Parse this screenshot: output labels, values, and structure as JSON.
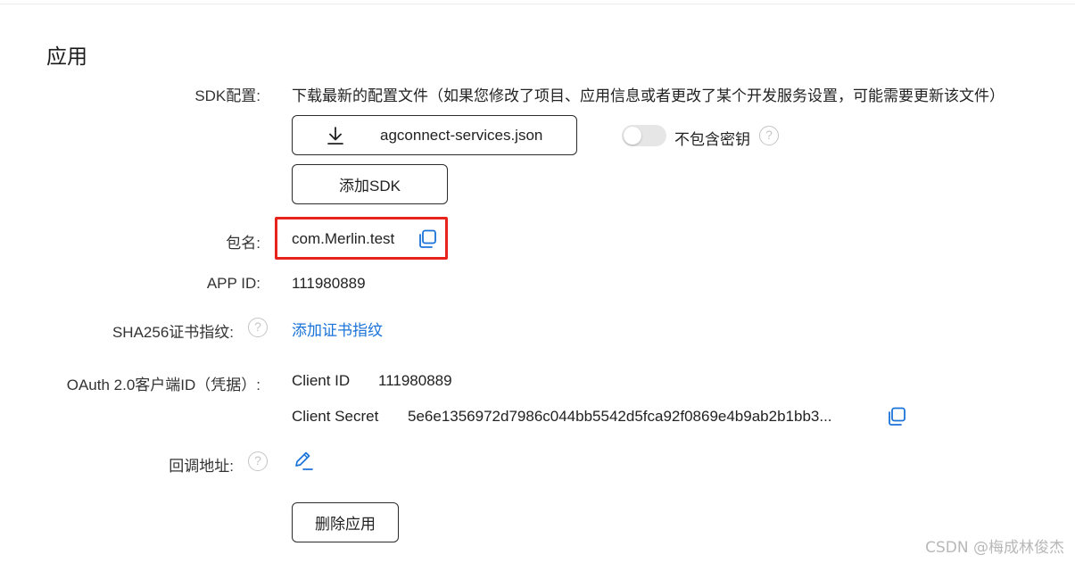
{
  "section": {
    "title": "应用"
  },
  "sdk": {
    "label": "SDK配置:",
    "description": "下载最新的配置文件（如果您修改了项目、应用信息或者更改了某个开发服务设置，可能需要更新该文件）",
    "download_file": "agconnect-services.json",
    "download_icon": "download-icon",
    "toggle_label": "不包含密钥",
    "toggle_on": false,
    "add_sdk_button": "添加SDK"
  },
  "package": {
    "label": "包名:",
    "value": "com.Merlin.test",
    "copy_icon": "copy-icon"
  },
  "appid": {
    "label": "APP ID:",
    "value": "111980889"
  },
  "sha256": {
    "label": "SHA256证书指纹:",
    "link": "添加证书指纹"
  },
  "oauth": {
    "label": "OAuth 2.0客户端ID（凭据）:",
    "client_id_label": "Client ID",
    "client_id": "111980889",
    "client_secret_label": "Client Secret",
    "client_secret": "5e6e1356972d7986c044bb5542d5fca92f0869e4b9ab2b1bb3..."
  },
  "callback": {
    "label": "回调地址:",
    "edit_icon": "edit-icon"
  },
  "delete_button": "删除应用",
  "help_glyph": "?",
  "watermark": "CSDN @梅成林俊杰",
  "colors": {
    "link": "#1a73d9",
    "highlight": "#e8231c",
    "border": "#2b2b2b"
  }
}
